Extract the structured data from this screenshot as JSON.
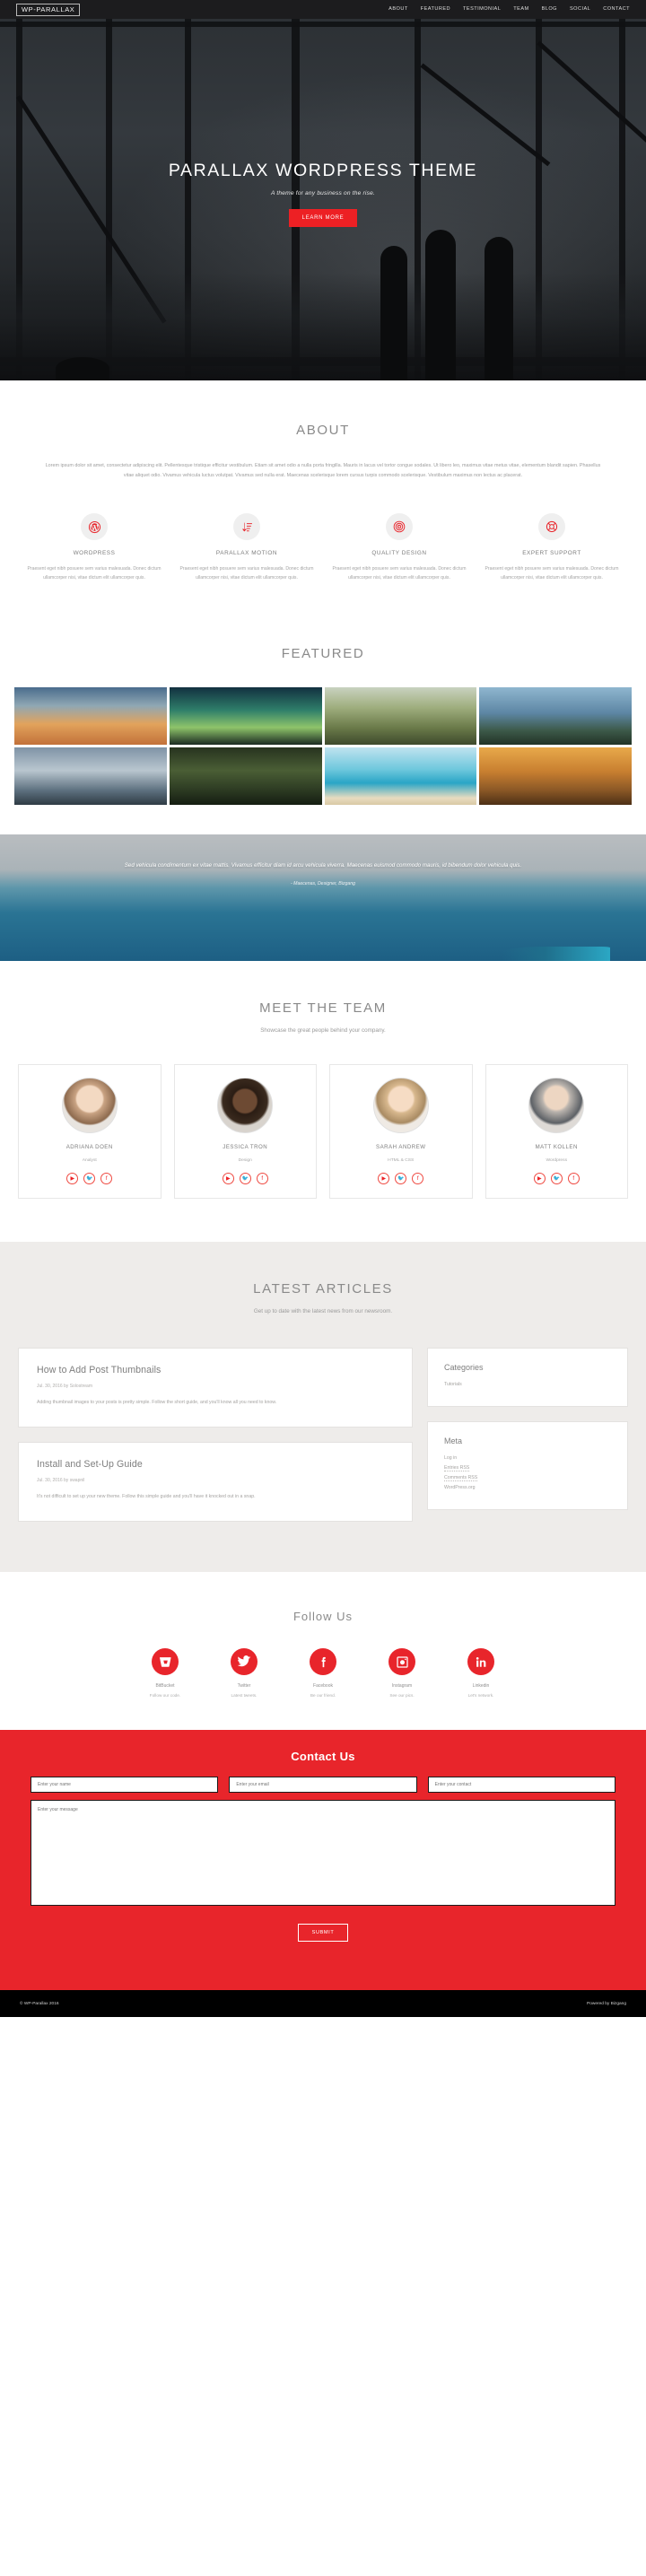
{
  "nav": {
    "brand": "WP-PARALLAX",
    "links": [
      {
        "label": "ABOUT"
      },
      {
        "label": "FEATURED"
      },
      {
        "label": "TESTIMONIAL"
      },
      {
        "label": "TEAM"
      },
      {
        "label": "BLOG"
      },
      {
        "label": "SOCIAL"
      },
      {
        "label": "CONTACT"
      }
    ]
  },
  "hero": {
    "title": "PARALLAX WORDPRESS THEME",
    "subtitle": "A theme for any business on the rise.",
    "cta": "LEARN MORE"
  },
  "about": {
    "title": "ABOUT",
    "body": "Lorem ipsum dolor sit amet, consectetur adipiscing elit. Pellentesque tristique efficitur vestibulum. Etiam sit amet odio a nulla porta fringilla. Mauris in lacus vel tortor congue sodales. Ut libero leo, maximus vitae metus vitae, elementum blandit sapien. Phasellus vitae aliquet odio. Vivamus vehicula luctus volutpat. Vivamus sed nulla erat. Maecenas scelerisque lorem cursus turpis commodo scelerisque. Vestibulum maximus non lectus ac placerat.",
    "features": [
      {
        "icon": "wordpress-icon",
        "title": "WORDPRESS",
        "text": "Praesent eget nibh posuere sem varius malesuada. Donec dictum ullamcorper nisi, vitae dictum elit ullamcorper quis."
      },
      {
        "icon": "sort-amount-down-icon",
        "title": "PARALLAX MOTION",
        "text": "Praesent eget nibh posuere sem varius malesuada. Donec dictum ullamcorper nisi, vitae dictum elit ullamcorper quis."
      },
      {
        "icon": "bullseye-icon",
        "title": "QUALITY DESIGN",
        "text": "Praesent eget nibh posuere sem varius malesuada. Donec dictum ullamcorper nisi, vitae dictum elit ullamcorper quis."
      },
      {
        "icon": "life-ring-icon",
        "title": "EXPERT SUPPORT",
        "text": "Praesent eget nibh posuere sem varius malesuada. Donec dictum ullamcorper nisi, vitae dictum elit ullamcorper quis."
      }
    ]
  },
  "featured": {
    "title": "FEATURED",
    "tiles": [
      {
        "alt": "sunset-clouds-photo"
      },
      {
        "alt": "aurora-forest-photo"
      },
      {
        "alt": "autumn-forest-photo"
      },
      {
        "alt": "mountain-lake-photo"
      },
      {
        "alt": "man-on-rock-lake-photo"
      },
      {
        "alt": "pine-forest-photo"
      },
      {
        "alt": "beach-boat-photo"
      },
      {
        "alt": "deer-in-fog-photo"
      }
    ]
  },
  "testimonial": {
    "quote": "Sed vehicula condimentum ex vitae mattis. Vivamus efficitur diam id arcu vehicula viverra. Maecenas euismod commodo mauris, id bibendum dolor vehicula quis.",
    "author": "- Maecenas, Designer, Bizgang"
  },
  "team": {
    "title": "MEET THE TEAM",
    "subtitle": "Showcase the great people behind your company.",
    "members": [
      {
        "name": "ADRIANA DOEN",
        "role": "Analyst",
        "socials": [
          "youtube-icon",
          "twitter-icon",
          "facebook-icon"
        ]
      },
      {
        "name": "JESSICA TRON",
        "role": "Design",
        "socials": [
          "youtube-icon",
          "twitter-icon",
          "facebook-icon"
        ]
      },
      {
        "name": "SARAH ANDREW",
        "role": "HTML & CSS",
        "socials": [
          "youtube-icon",
          "twitter-icon",
          "facebook-icon"
        ]
      },
      {
        "name": "MATT KOLLEN",
        "role": "Wordpress",
        "socials": [
          "youtube-icon",
          "twitter-icon",
          "facebook-icon"
        ]
      }
    ]
  },
  "blog": {
    "title": "LATEST ARTICLES",
    "subtitle": "Get up to date with the latest news from our newsroom.",
    "posts": [
      {
        "title": "How to Add Post Thumbnails",
        "meta": "Jul. 30, 2016 by Solostream",
        "excerpt": "Adding thumbnail images to your posts is pretty simple. Follow the short guide, and you'll know all you need to know."
      },
      {
        "title": "Install and Set-Up Guide",
        "meta": "Jul. 30, 2016 by swapnil",
        "excerpt": "It's not difficult to set up your new theme. Follow this simple guide and you'll have it knocked out in a snap."
      }
    ],
    "widgets": [
      {
        "title": "Categories",
        "items": [
          "Tutorials"
        ]
      },
      {
        "title": "Meta",
        "items": [
          "Log in",
          "Entries RSS",
          "Comments RSS",
          "WordPress.org"
        ]
      }
    ]
  },
  "follow": {
    "title": "Follow Us",
    "items": [
      {
        "icon": "bitbucket-icon",
        "name": "BitBucket",
        "desc": "Follow our code."
      },
      {
        "icon": "twitter-icon",
        "name": "Twitter",
        "desc": "Latest tweets."
      },
      {
        "icon": "facebook-icon",
        "name": "Facebook",
        "desc": "Be our friend."
      },
      {
        "icon": "instagram-icon",
        "name": "Instagram",
        "desc": "See our pics."
      },
      {
        "icon": "linkedin-icon",
        "name": "Linkedin",
        "desc": "Let's network."
      }
    ]
  },
  "contact": {
    "title": "Contact Us",
    "name_placeholder": "Enter your name",
    "email_placeholder": "Enter your email",
    "phone_placeholder": "Enter your contact",
    "message_placeholder": "Enter your message",
    "name_value": "",
    "email_value": "",
    "phone_value": "",
    "message_value": "",
    "submit": "SUBMIT"
  },
  "footer": {
    "copyright": "© WP-Parallax 2016",
    "powered": "Powered by Bizgang"
  },
  "colors": {
    "accent": "#e8252b",
    "hero_button": "#ed2024",
    "navbar": "#1c1c1e",
    "blog_bg": "#eeecea",
    "footer": "#000000"
  }
}
